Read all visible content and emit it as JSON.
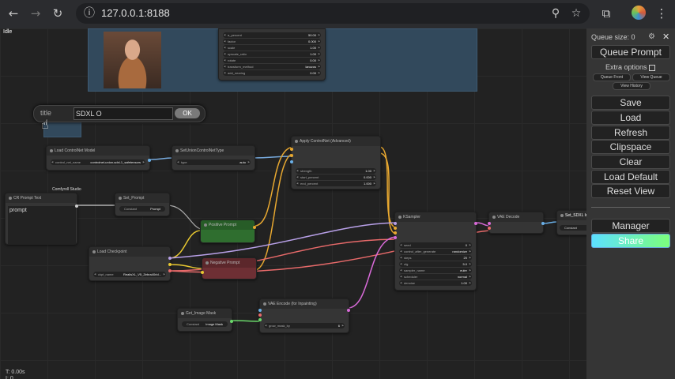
{
  "browser": {
    "url": "127.0.0.1:8188"
  },
  "canvas": {
    "status": "Idle",
    "timing": "T: 0.00s\nI: 0"
  },
  "top_group": {
    "widgets": [
      {
        "name": "a_percent",
        "value": "50.00"
      },
      {
        "name": "factor",
        "value": "0.000"
      },
      {
        "name": "scale",
        "value": "1.00"
      },
      {
        "name": "upscale_ratio",
        "value": "1.00"
      },
      {
        "name": "rotate",
        "value": "0.00"
      },
      {
        "name": "transform_method",
        "value": "lanczos"
      },
      {
        "name": "add_nearing",
        "value": "0.00"
      }
    ]
  },
  "title_editor": {
    "label": "title",
    "value": "SDXL O",
    "ok_label": "OK"
  },
  "nodes": {
    "load_controlnet": {
      "title": "Load ControlNet Model",
      "widget_name": "control_net_name",
      "widget_value": "controlnet-union-sdxl-1_safetensors"
    },
    "set_union": {
      "title": "SetUnionControlNetType",
      "widget_name": "type",
      "widget_value": "auto"
    },
    "apply_controlnet": {
      "title": "Apply ControlNet (Advanced)",
      "widgets": [
        {
          "name": "strength",
          "value": "1.00"
        },
        {
          "name": "start_percent",
          "value": "0.000"
        },
        {
          "name": "end_percent",
          "value": "1.000"
        }
      ]
    },
    "cr_prompt": {
      "group_label": "Comfyroll Studio",
      "title": "CR Prompt Text",
      "text": "prompt"
    },
    "set_prompt": {
      "title": "Set_Prompt",
      "widget_name": "Constant",
      "widget_value": "Prompt"
    },
    "positive": {
      "title": "Positive Prompt"
    },
    "negative": {
      "title": "Negative Prompt"
    },
    "load_checkpoint": {
      "title": "Load Checkpoint",
      "widget_name": "ckpt_name",
      "widget_value": "RealisXL_V5_Zebra40rid..."
    },
    "ksampler": {
      "title": "KSampler",
      "widgets": [
        {
          "name": "seed",
          "value": "0"
        },
        {
          "name": "control_after_generate",
          "value": "randomize"
        },
        {
          "name": "steps",
          "value": "20"
        },
        {
          "name": "cfg",
          "value": "5.0"
        },
        {
          "name": "sampler_name",
          "value": "euler"
        },
        {
          "name": "scheduler",
          "value": "normal"
        },
        {
          "name": "denoise",
          "value": "1.00"
        }
      ]
    },
    "vae_decode": {
      "title": "VAE Decode"
    },
    "set_sdxl": {
      "title": "Set_SDXL In",
      "widget_value": "Constant"
    },
    "get_image_mask": {
      "title": "Get_Image Mask",
      "widget_name": "Constant",
      "widget_value": "Image Mask"
    },
    "vae_encode": {
      "title": "VAE Encode (for Inpainting)",
      "widget_name": "grow_mask_by",
      "widget_value": "6"
    }
  },
  "panel": {
    "queue_size": "Queue size: 0",
    "queue_prompt": "Queue Prompt",
    "extra_options": "Extra options",
    "queue_front": "Queue Front",
    "view_queue": "View Queue",
    "view_history": "View History",
    "save": "Save",
    "load": "Load",
    "refresh": "Refresh",
    "clipspace": "Clipspace",
    "clear": "Clear",
    "load_default": "Load Default",
    "reset_view": "Reset View",
    "manager": "Manager",
    "share": "Share"
  },
  "colors": {
    "positive_node": "#2f6e2f",
    "negative_node": "#6e2f34",
    "group_bg": "#32495c",
    "share_gradient_start": "#5ce0ff",
    "share_gradient_end": "#7cff7c"
  }
}
